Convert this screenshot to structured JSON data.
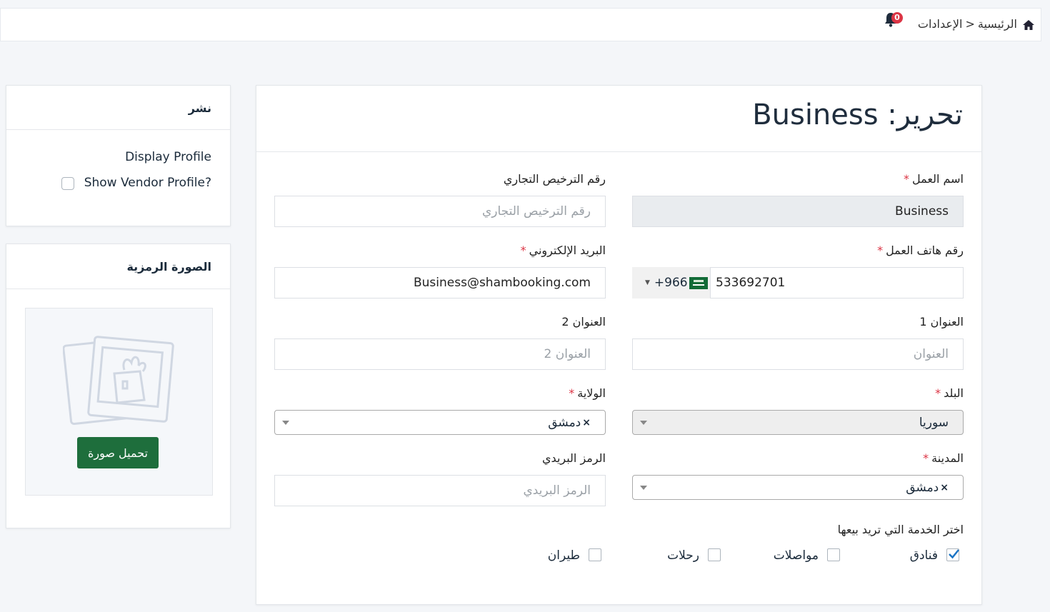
{
  "breadcrumb": {
    "home": "الرئيسية",
    "separator": "<",
    "current": "الإعدادات"
  },
  "notifications": {
    "count": "0"
  },
  "main": {
    "title": "تحرير: Business",
    "fields": {
      "business_name": {
        "label": "اسم العمل",
        "required": "*",
        "value": "Business"
      },
      "license": {
        "label": "رقم الترخيص التجاري",
        "placeholder": "رقم الترخيص التجاري"
      },
      "phone": {
        "label": "رقم هاتف العمل",
        "required": "*",
        "dial_code": "+966",
        "value": "533692701"
      },
      "email": {
        "label": "البريد الإلكتروني",
        "required": "*",
        "value": "Business@shambooking.com"
      },
      "address1": {
        "label": "العنوان 1",
        "placeholder": "العنوان"
      },
      "address2": {
        "label": "العنوان 2",
        "placeholder": "العنوان 2"
      },
      "country": {
        "label": "البلد",
        "required": "*",
        "value": "سوريا"
      },
      "state": {
        "label": "الولاية",
        "required": "*",
        "value": "دمشق",
        "clear": "×"
      },
      "city": {
        "label": "المدينة",
        "required": "*",
        "value": "دمشق",
        "clear": "×"
      },
      "zip": {
        "label": "الرمز البريدي",
        "placeholder": "الرمز البريدي"
      }
    },
    "services": {
      "label": "اختر الخدمة التي تريد بيعها",
      "items": [
        {
          "label": "فنادق",
          "checked": true
        },
        {
          "label": "مواصلات",
          "checked": false
        },
        {
          "label": "رحلات",
          "checked": false
        },
        {
          "label": "طيران",
          "checked": false
        }
      ]
    }
  },
  "publish": {
    "title": "نشر",
    "display_profile": "Display Profile",
    "show_vendor": "Show Vendor Profile?"
  },
  "avatar": {
    "title": "الصورة الرمزية",
    "upload_label": "تحميل صورة"
  },
  "colors": {
    "accent": "#1e6e3c",
    "danger": "#dc3545",
    "check": "#1b74c5"
  }
}
